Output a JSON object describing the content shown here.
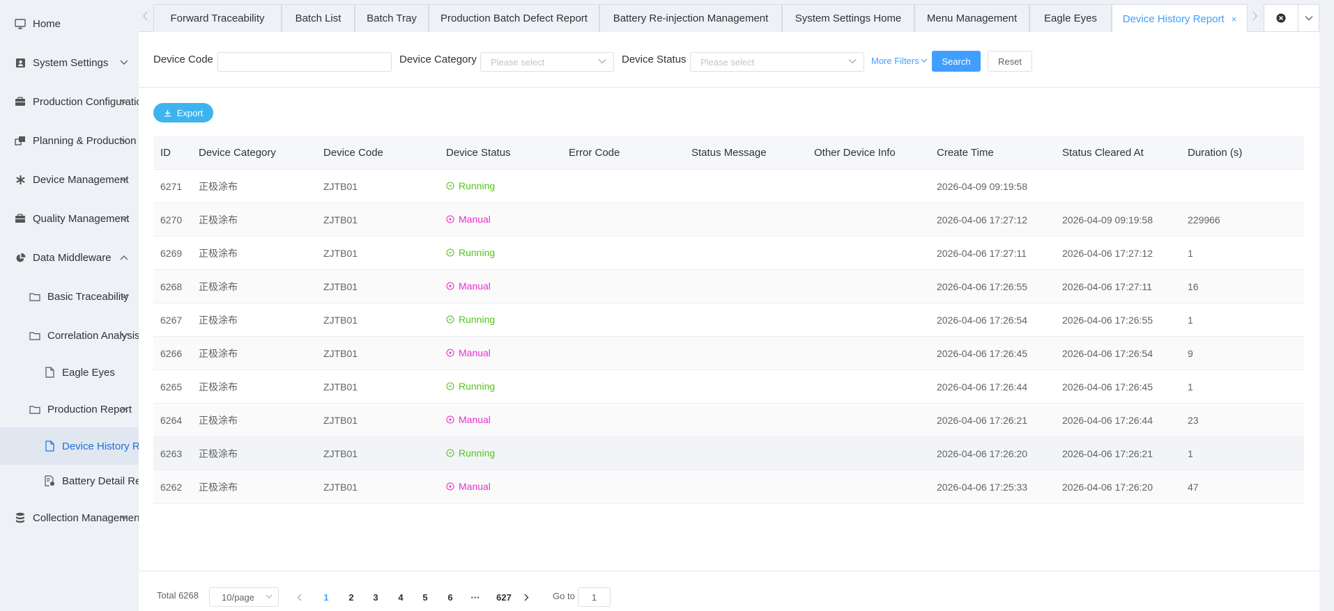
{
  "sidebar": {
    "items": [
      {
        "label": "Home",
        "icon": "monitor-icon",
        "expandable": false
      },
      {
        "label": "System Settings",
        "icon": "user-card-icon",
        "expandable": true,
        "expanded": false
      },
      {
        "label": "Production Configuration",
        "icon": "briefcase-icon",
        "expandable": true,
        "expanded": false
      },
      {
        "label": "Planning & Production",
        "icon": "windows-icon",
        "expandable": true,
        "expanded": false
      },
      {
        "label": "Device Management",
        "icon": "asterisk-icon",
        "expandable": true,
        "expanded": false
      },
      {
        "label": "Quality Management",
        "icon": "briefcase-icon",
        "expandable": true,
        "expanded": false
      },
      {
        "label": "Data Middleware",
        "icon": "pie-chart-icon",
        "expandable": true,
        "expanded": true
      },
      {
        "label": "Basic Traceability",
        "icon": "folder-icon",
        "expandable": true,
        "expanded": false
      },
      {
        "label": "Correlation Analysis",
        "icon": "folder-icon",
        "expandable": true,
        "expanded": false
      },
      {
        "label": "Eagle Eyes",
        "icon": "document-icon",
        "expandable": false
      },
      {
        "label": "Production Report",
        "icon": "folder-icon",
        "expandable": true,
        "expanded": true
      },
      {
        "label": "Device History Report",
        "icon": "document-icon",
        "expandable": false,
        "active": true
      },
      {
        "label": "Battery Detail Report",
        "icon": "document-chart-icon",
        "expandable": false
      },
      {
        "label": "Collection Management",
        "icon": "database-icon",
        "expandable": true,
        "expanded": false
      }
    ]
  },
  "tabs": {
    "items": [
      {
        "label": "Forward Traceability"
      },
      {
        "label": "Batch List"
      },
      {
        "label": "Batch Tray"
      },
      {
        "label": "Production Batch Defect Report"
      },
      {
        "label": "Battery Re-injection Management"
      },
      {
        "label": "System Settings Home"
      },
      {
        "label": "Menu Management"
      },
      {
        "label": "Eagle Eyes"
      },
      {
        "label": "Device History Report",
        "active": true,
        "close": "×"
      }
    ]
  },
  "filters": {
    "device_code_label": "Device Code",
    "device_code_value": "",
    "device_category_label": "Device Category",
    "device_category_placeholder": "Please select",
    "device_status_label": "Device Status",
    "device_status_placeholder": "Please select",
    "more_filters": "More Filters",
    "search": "Search",
    "reset": "Reset"
  },
  "toolbar": {
    "export": "Export"
  },
  "table": {
    "columns": [
      "ID",
      "Device Category",
      "Device Code",
      "Device Status",
      "Error Code",
      "Status Message",
      "Other Device Info",
      "Create Time",
      "Status Cleared At",
      "Duration (s)"
    ],
    "rows": [
      {
        "id": "6271",
        "category": "正极涂布",
        "code": "ZJTB01",
        "status": "Running",
        "error": "",
        "message": "",
        "other": "",
        "create": "2026-04-09 09:19:58",
        "cleared": "",
        "duration": ""
      },
      {
        "id": "6270",
        "category": "正极涂布",
        "code": "ZJTB01",
        "status": "Manual",
        "error": "",
        "message": "",
        "other": "",
        "create": "2026-04-06 17:27:12",
        "cleared": "2026-04-09 09:19:58",
        "duration": "229966"
      },
      {
        "id": "6269",
        "category": "正极涂布",
        "code": "ZJTB01",
        "status": "Running",
        "error": "",
        "message": "",
        "other": "",
        "create": "2026-04-06 17:27:11",
        "cleared": "2026-04-06 17:27:12",
        "duration": "1"
      },
      {
        "id": "6268",
        "category": "正极涂布",
        "code": "ZJTB01",
        "status": "Manual",
        "error": "",
        "message": "",
        "other": "",
        "create": "2026-04-06 17:26:55",
        "cleared": "2026-04-06 17:27:11",
        "duration": "16"
      },
      {
        "id": "6267",
        "category": "正极涂布",
        "code": "ZJTB01",
        "status": "Running",
        "error": "",
        "message": "",
        "other": "",
        "create": "2026-04-06 17:26:54",
        "cleared": "2026-04-06 17:26:55",
        "duration": "1"
      },
      {
        "id": "6266",
        "category": "正极涂布",
        "code": "ZJTB01",
        "status": "Manual",
        "error": "",
        "message": "",
        "other": "",
        "create": "2026-04-06 17:26:45",
        "cleared": "2026-04-06 17:26:54",
        "duration": "9"
      },
      {
        "id": "6265",
        "category": "正极涂布",
        "code": "ZJTB01",
        "status": "Running",
        "error": "",
        "message": "",
        "other": "",
        "create": "2026-04-06 17:26:44",
        "cleared": "2026-04-06 17:26:45",
        "duration": "1"
      },
      {
        "id": "6264",
        "category": "正极涂布",
        "code": "ZJTB01",
        "status": "Manual",
        "error": "",
        "message": "",
        "other": "",
        "create": "2026-04-06 17:26:21",
        "cleared": "2026-04-06 17:26:44",
        "duration": "23"
      },
      {
        "id": "6263",
        "category": "正极涂布",
        "code": "ZJTB01",
        "status": "Running",
        "error": "",
        "message": "",
        "other": "",
        "create": "2026-04-06 17:26:20",
        "cleared": "2026-04-06 17:26:21",
        "duration": "1"
      },
      {
        "id": "6262",
        "category": "正极涂布",
        "code": "ZJTB01",
        "status": "Manual",
        "error": "",
        "message": "",
        "other": "",
        "create": "2026-04-06 17:25:33",
        "cleared": "2026-04-06 17:26:20",
        "duration": "47"
      }
    ]
  },
  "pagination": {
    "total": "Total 6268",
    "page_size": "10/page",
    "pages": [
      "1",
      "2",
      "3",
      "4",
      "5",
      "6"
    ],
    "ellipsis": "···",
    "last_page": "627",
    "current_page": "1",
    "goto_label": "Go to",
    "goto_value": "1"
  },
  "colors": {
    "primary": "#409eff",
    "running": "#52c41a",
    "manual": "#eb2fd0",
    "export": "#3db4ee"
  }
}
